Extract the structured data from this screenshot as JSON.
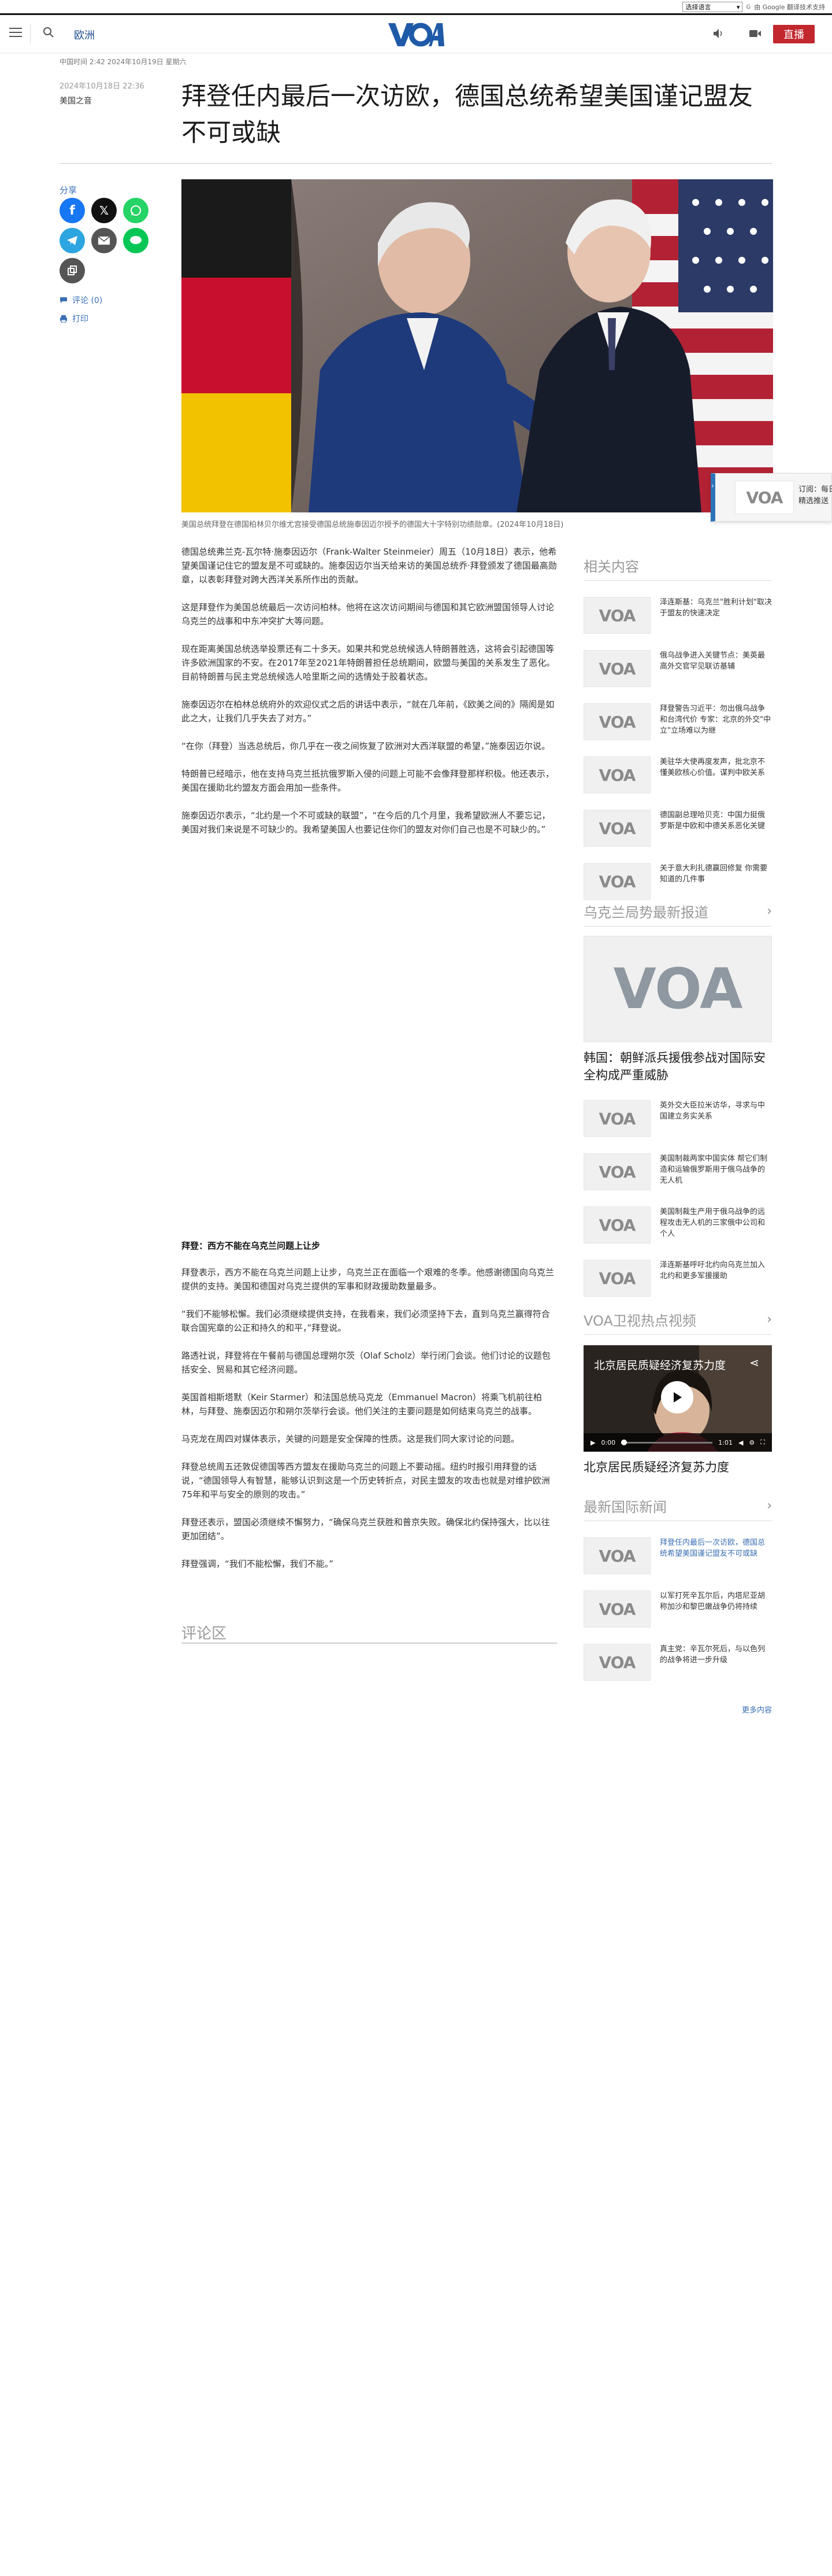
{
  "translate_bar": {
    "select_label": "选择语言",
    "powered_by": "由 Google 翻译技术支持"
  },
  "header": {
    "section": "欧洲",
    "logo_text": "VOA",
    "live_label": "直播"
  },
  "article": {
    "updated": "中国时间 2:42 2024年10月19日 星期六",
    "date": "2024年10月18日 22:36",
    "author": "美国之音",
    "headline": "拜登任内最后一次访欧，德国总统希望美国谨记盟友不可或缺",
    "caption": "美国总统拜登在德国柏林贝尔维尤宫接受德国总统施泰因迈尔授予的德国大十字特别功绩勋章。(2024年10月18日)",
    "paragraphs_1": [
      "德国总统弗兰克-瓦尔特·施泰因迈尔（Frank-Walter Steinmeier）周五（10月18日）表示，他希望美国谨记住它的盟友是不可或缺的。施泰因迈尔当天给来访的美国总统乔·拜登颁发了德国最高勋章，以表彰拜登对跨大西洋关系所作出的贡献。",
      "这是拜登作为美国总统最后一次访问柏林。他将在这次访问期间与德国和其它欧洲盟国领导人讨论乌克兰的战事和中东冲突扩大等问题。",
      "现在距离美国总统选举投票还有二十多天。如果共和党总统候选人特朗普胜选，这将会引起德国等许多欧洲国家的不安。在2017年至2021年特朗普担任总统期间，欧盟与美国的关系发生了恶化。目前特朗普与民主党总统候选人哈里斯之间的选情处于胶着状态。",
      "施泰因迈尔在柏林总统府外的欢迎仪式之后的讲话中表示，“就在几年前，《欧美之间的》隔阂是如此之大，让我们几乎失去了对方。”",
      "“在你（拜登）当选总统后，你几乎在一夜之间恢复了欧洲对大西洋联盟的希望，”施泰因迈尔说。",
      "特朗普已经暗示，他在支持乌克兰抵抗俄罗斯入侵的问题上可能不会像拜登那样积极。他还表示，美国在援助北约盟友方面会用加一些条件。",
      "施泰因迈尔表示，“北约是一个不可或缺的联盟”，“在今后的几个月里，我希望欧洲人不要忘记，美国对我们来说是不可缺少的。我希望美国人也要记住你们的盟友对你们自己也是不可缺少的。”"
    ],
    "subhead": "拜登：西方不能在乌克兰问题上让步",
    "paragraphs_2": [
      "拜登表示，西方不能在乌克兰问题上让步，乌克兰正在面临一个艰难的冬季。他感谢德国向乌克兰提供的支持。美国和德国对乌克兰提供的军事和财政援助数量最多。",
      "“我们不能够松懈。我们必须继续提供支持，在我看来，我们必须坚持下去，直到乌克兰赢得符合联合国宪章的公正和持久的和平，”拜登说。",
      "路透社说，拜登将在午餐前与德国总理朔尔茨（Olaf Scholz）举行闭门会谈。他们讨论的议题包括安全、贸易和其它经济问题。",
      "英国首相斯塔默（Keir Starmer）和法国总统马克龙（Emmanuel Macron）将乘飞机前往柏林，与拜登、施泰因迈尔和朔尔茨举行会谈。他们关注的主要问题是如何结束乌克兰的战事。",
      "马克龙在周四对媒体表示，关键的问题是安全保障的性质。这是我们同大家讨论的问题。",
      "拜登总统周五还敦促德国等西方盟友在援助乌克兰的问题上不要动摇。纽约时报引用拜登的话说，“德国领导人有智慧，能够认识到这是一个历史转折点，对民主盟友的攻击也就是对维护欧洲75年和平与安全的原则的攻击。”",
      "拜登还表示，盟国必须继续不懈努力，“确保乌克兰获胜和普京失败。确保北约保持强大，比以往更加团结”。",
      "拜登强调，“我们不能松懈，我们不能。”"
    ],
    "comments_title": "评论区"
  },
  "share": {
    "label": "分享",
    "comment_link": "评论 (0)",
    "print_link": "打印"
  },
  "sticky": {
    "text": "订阅：每日精选推送"
  },
  "sidebar": {
    "related_title": "相关内容",
    "related": [
      "泽连斯基：乌克兰\"胜利计划\"取决于盟友的快速决定",
      "俄乌战争进入关键节点：美英最高外交官罕见联访基辅",
      "拜登警告习近平：勿出俄乌战争和台湾代价 专家：北京的外交\"中立\"立场难以为继",
      "美驻华大使再度发声，批北京不懂美欧核心价值。谋判中欧关系",
      "德国副总理哈贝克：中国力挺俄罗斯是中欧和中德关系恶化关键",
      "关于意大利扎德赢回修复 你需要知道的几件事"
    ],
    "ukraine_title": "乌克兰局势最新报道",
    "ukraine_lead": "韩国：朝鲜派兵援俄参战对国际安全构成严重威胁",
    "ukraine": [
      "英外交大臣拉米访华，寻求与中国建立务实关系",
      "美国制裁两家中国实体 帮它们制造和运输俄罗斯用于俄乌战争的无人机",
      "美国制裁生产用于俄乌战争的远程攻击无人机的三家俄中公司和个人",
      "泽连斯基呼吁北约向乌克兰加入北约和更多军援援助"
    ],
    "tv_title": "VOA卫视热点视频",
    "video": {
      "overlay_title": "北京居民质疑经济复苏力度",
      "current_time": "0:00",
      "duration": "1:01",
      "caption": "北京居民质疑经济复苏力度"
    },
    "intl_title": "最新国际新闻",
    "intl": [
      "拜登任内最后一次访欧，德国总统希望美国谨记盟友不可或缺",
      "以军打死辛瓦尔后，内塔尼亚胡称加沙和黎巴嫩战争仍将持续",
      "真主党：辛瓦尔死后，与以色列的战争将进一步升级"
    ],
    "more": "更多内容"
  },
  "colors": {
    "brand_blue": "#1f4f8f",
    "live_red": "#c1272d",
    "link_blue": "#3a6fb4"
  }
}
